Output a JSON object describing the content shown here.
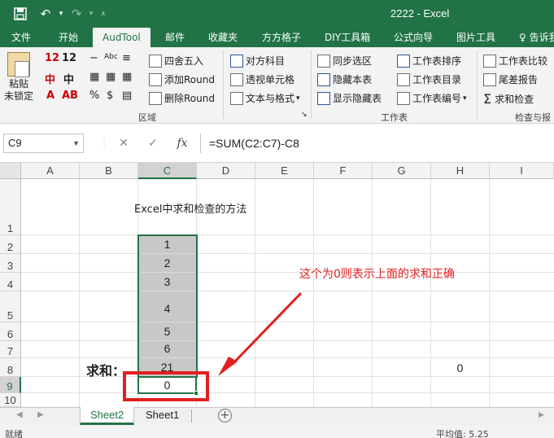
{
  "window": {
    "title": "2222 - Excel",
    "accent": "#217346"
  },
  "qat": {
    "save_icon": "save-icon",
    "undo_icon": "undo-icon",
    "redo_icon": "redo-icon",
    "customize_icon": "customize-icon"
  },
  "tabs": [
    {
      "label": "文件"
    },
    {
      "label": "开始"
    },
    {
      "label": "AudTool",
      "active": true
    },
    {
      "label": "邮件"
    },
    {
      "label": "收藏夹"
    },
    {
      "label": "方方格子"
    },
    {
      "label": "DIY工具箱"
    },
    {
      "label": "公式向导"
    },
    {
      "label": "图片工具"
    },
    {
      "label": "告诉我"
    }
  ],
  "ribbon": {
    "paste_label": "粘贴",
    "unlock_label": "未锁定",
    "glyphs": {
      "g1": "12",
      "g2": "中",
      "g3": "A",
      "g4": "%",
      "g5": "$",
      "g6": "Abc",
      "g7": "12",
      "g8": "中",
      "g9": "AB"
    },
    "round": {
      "round45": "四舍五入",
      "add_round": "添加Round",
      "del_round": "删除Round"
    },
    "group1_label": "区域",
    "format": {
      "compare": "对方科目",
      "perspective": "透视单元格",
      "text_format": "文本与格式"
    },
    "sheet": {
      "sync": "同步选区",
      "hide": "隐藏本表",
      "show_hidden": "显示隐藏表",
      "sort": "工作表排序",
      "directory": "工作表目录",
      "numbering": "工作表编号"
    },
    "group2_label": "工作表",
    "check": {
      "compare": "工作表比较",
      "diff": "尾差报告",
      "sum_check": "求和检查"
    },
    "group3_label": "检查与报"
  },
  "formula_bar": {
    "name_box": "C9",
    "cancel": "✕",
    "enter": "✓",
    "fx": "fx",
    "formula": "=SUM(C2:C7)-C8"
  },
  "columns": [
    "A",
    "B",
    "C",
    "D",
    "E",
    "F",
    "G",
    "H",
    "I"
  ],
  "rows": [
    "1",
    "2",
    "3",
    "4",
    "5",
    "6",
    "7",
    "8",
    "9",
    "10"
  ],
  "cells": {
    "title": "Excel中求和检查的方法",
    "c_values": [
      "1",
      "2",
      "3",
      "4",
      "5",
      "6",
      "21"
    ],
    "c9": "0",
    "b8": "求和：",
    "h8": "0"
  },
  "annotation": {
    "text": "这个为0则表示上面的求和正确",
    "color": "#e02020"
  },
  "sheets": [
    {
      "label": "Sheet2",
      "active": true
    },
    {
      "label": "Sheet1"
    }
  ],
  "status": {
    "ready": "就绪",
    "average": "平均值: 5.25"
  }
}
